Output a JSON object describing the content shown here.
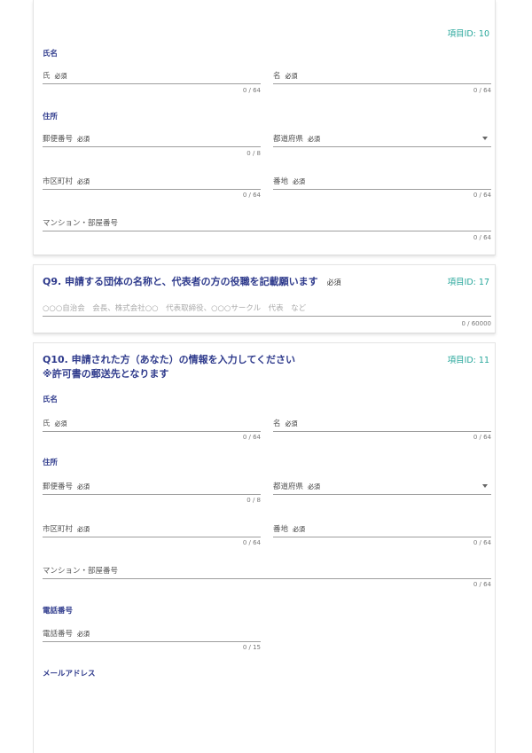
{
  "req": "必須",
  "q_prev": {
    "item_id": "項目ID: 10",
    "name_section": "氏名",
    "last_name": {
      "label": "氏",
      "counter": "0 / 64"
    },
    "first_name": {
      "label": "名",
      "counter": "0 / 64"
    },
    "address_section": "住所",
    "postal": {
      "label": "郵便番号",
      "counter": "0 / 8"
    },
    "prefecture": {
      "label": "都道府県"
    },
    "city": {
      "label": "市区町村",
      "counter": "0 / 64"
    },
    "block": {
      "label": "番地",
      "counter": "0 / 64"
    },
    "building": {
      "label": "マンション・部屋番号",
      "counter": "0 / 64"
    }
  },
  "q9": {
    "title": "Q9. 申請する団体の名称と、代表者の方の役職を記載願います",
    "item_id": "項目ID: 17",
    "placeholder": "○○○自治会　会長、株式会社○○　代表取締役、○○○サークル　代表　など",
    "counter": "0 / 60000"
  },
  "q10": {
    "title_line1": "Q10. 申請された方（あなた）の情報を入力してください",
    "title_line2": "※許可書の郵送先となります",
    "item_id": "項目ID: 11",
    "name_section": "氏名",
    "last_name": {
      "label": "氏",
      "counter": "0 / 64"
    },
    "first_name": {
      "label": "名",
      "counter": "0 / 64"
    },
    "address_section": "住所",
    "postal": {
      "label": "郵便番号",
      "counter": "0 / 8"
    },
    "prefecture": {
      "label": "都道府県"
    },
    "city": {
      "label": "市区町村",
      "counter": "0 / 64"
    },
    "block": {
      "label": "番地",
      "counter": "0 / 64"
    },
    "building": {
      "label": "マンション・部屋番号",
      "counter": "0 / 64"
    },
    "phone_section": "電話番号",
    "phone": {
      "label": "電話番号",
      "counter": "0 / 15"
    },
    "email_section": "メールアドレス"
  }
}
